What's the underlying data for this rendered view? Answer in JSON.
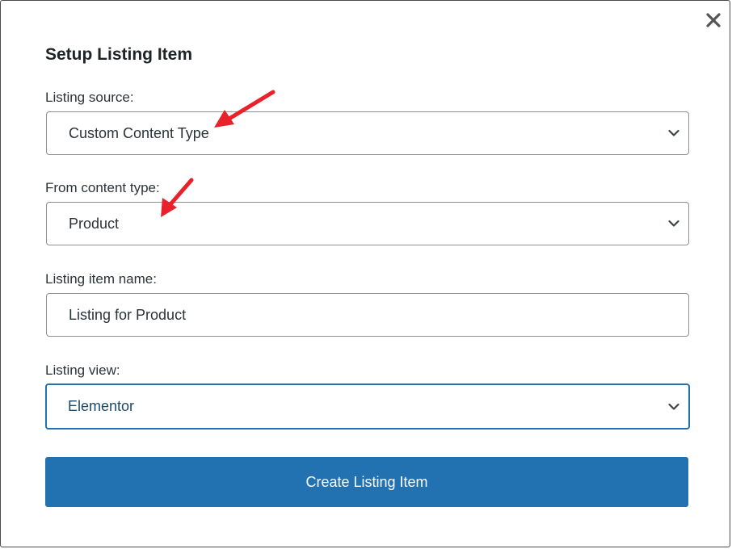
{
  "dialog": {
    "title": "Setup Listing Item",
    "close_icon": "close-icon"
  },
  "form": {
    "listing_source": {
      "label": "Listing source:",
      "value": "Custom Content Type"
    },
    "content_type": {
      "label": "From content type:",
      "value": "Product"
    },
    "item_name": {
      "label": "Listing item name:",
      "value": "Listing for Product"
    },
    "listing_view": {
      "label": "Listing view:",
      "value": "Elementor"
    },
    "submit_label": "Create Listing Item"
  },
  "annotations": {
    "arrow_color": "#e8212a"
  },
  "colors": {
    "primary": "#2271b1",
    "focus_border": "#2271b1"
  }
}
